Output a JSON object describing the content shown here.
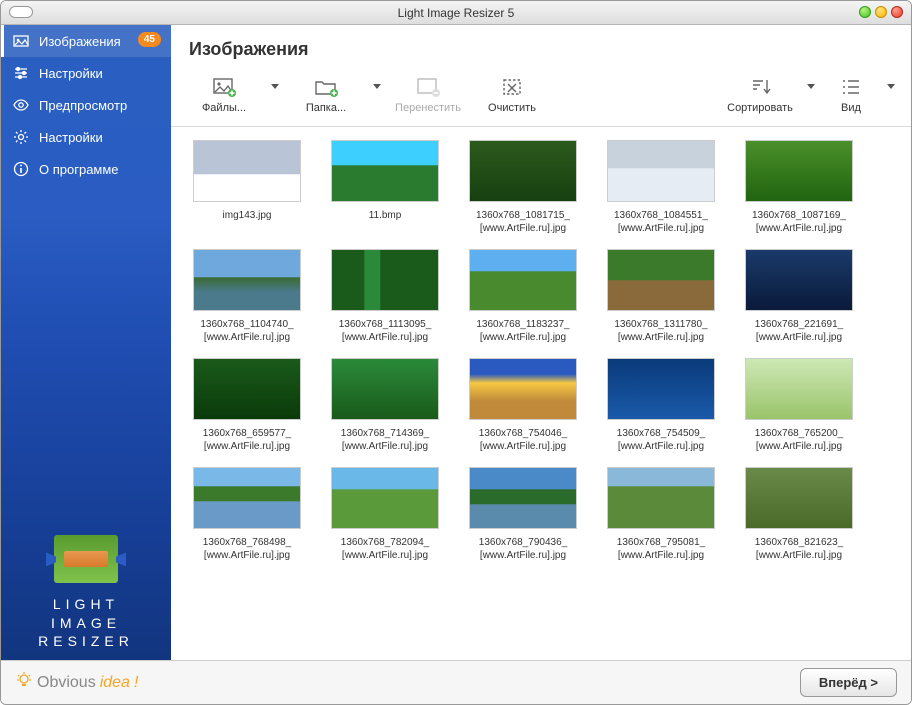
{
  "window": {
    "title": "Light Image Resizer 5"
  },
  "sidebar": {
    "items": [
      {
        "label": "Изображения",
        "badge": "45"
      },
      {
        "label": "Настройки"
      },
      {
        "label": "Предпросмотр"
      },
      {
        "label": "Настройки"
      },
      {
        "label": "О программе"
      }
    ],
    "logo": {
      "line1": "LIGHT",
      "line2": "IMAGE",
      "line3": "RESIZER"
    }
  },
  "main": {
    "header": "Изображения",
    "toolbar": {
      "files": "Файлы...",
      "folder": "Папка...",
      "move": "Перенестить",
      "clear": "Очистить",
      "sort": "Сортировать",
      "view": "Вид"
    },
    "thumbs": [
      {
        "name": "img143.jpg",
        "cls": "tg-winter"
      },
      {
        "name": "11.bmp",
        "cls": "tg-mtn"
      },
      {
        "name": "1360x768_1081715_[www.ArtFile.ru].jpg",
        "cls": "tg-forest"
      },
      {
        "name": "1360x768_1084551_[www.ArtFile.ru].jpg",
        "cls": "tg-snow"
      },
      {
        "name": "1360x768_1087169_[www.ArtFile.ru].jpg",
        "cls": "tg-green"
      },
      {
        "name": "1360x768_1104740_[www.ArtFile.ru].jpg",
        "cls": "tg-lake"
      },
      {
        "name": "1360x768_1113095_[www.ArtFile.ru].jpg",
        "cls": "tg-falls"
      },
      {
        "name": "1360x768_1183237_[www.ArtFile.ru].jpg",
        "cls": "tg-valley"
      },
      {
        "name": "1360x768_1311780_[www.ArtFile.ru].jpg",
        "cls": "tg-stump"
      },
      {
        "name": "1360x768_221691_[www.ArtFile.ru].jpg",
        "cls": "tg-dusk"
      },
      {
        "name": "1360x768_659577_[www.ArtFile.ru].jpg",
        "cls": "tg-moss"
      },
      {
        "name": "1360x768_714369_[www.ArtFile.ru].jpg",
        "cls": "tg-lush"
      },
      {
        "name": "1360x768_754046_[www.ArtFile.ru].jpg",
        "cls": "tg-sunset"
      },
      {
        "name": "1360x768_754509_[www.ArtFile.ru].jpg",
        "cls": "tg-planet"
      },
      {
        "name": "1360x768_765200_[www.ArtFile.ru].jpg",
        "cls": "tg-birch"
      },
      {
        "name": "1360x768_768498_[www.ArtFile.ru].jpg",
        "cls": "tg-river"
      },
      {
        "name": "1360x768_782094_[www.ArtFile.ru].jpg",
        "cls": "tg-field"
      },
      {
        "name": "1360x768_790436_[www.ArtFile.ru].jpg",
        "cls": "tg-pond"
      },
      {
        "name": "1360x768_795081_[www.ArtFile.ru].jpg",
        "cls": "tg-path"
      },
      {
        "name": "1360x768_821623_[www.ArtFile.ru].jpg",
        "cls": "tg-mush"
      }
    ]
  },
  "footer": {
    "brand_a": "Obvious",
    "brand_b": "idea",
    "brand_c": "!",
    "next": "Вперёд >"
  }
}
